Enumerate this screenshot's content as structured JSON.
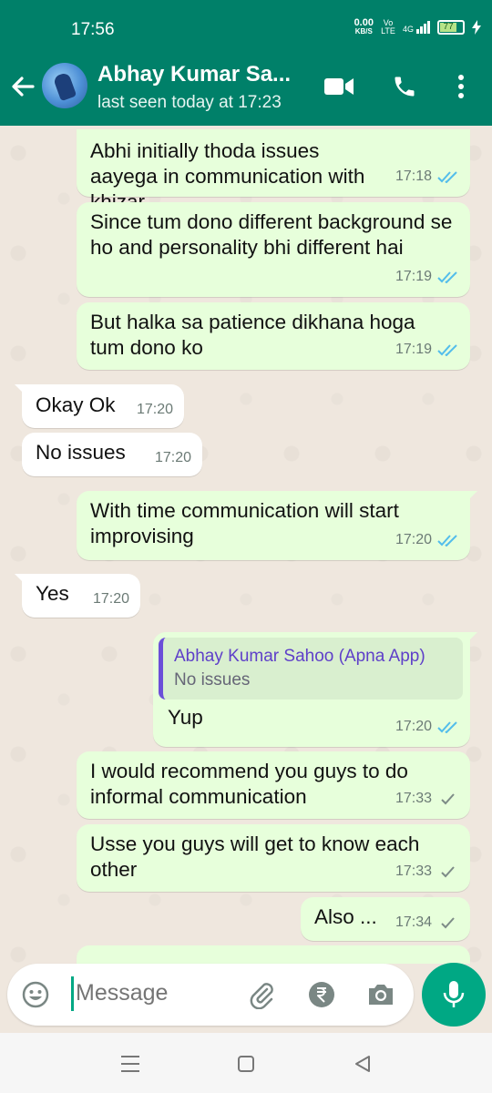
{
  "status_bar": {
    "time": "17:56",
    "net_speed_value": "0.00",
    "net_speed_unit": "KB/S",
    "volte": "Vo LTE",
    "network": "4G",
    "battery": "77"
  },
  "header": {
    "contact_name": "Abhay Kumar Sa...",
    "last_seen": "last seen today at 17:23",
    "icons": [
      "back-arrow-icon",
      "video-call-icon",
      "phone-icon",
      "more-vert-icon"
    ]
  },
  "messages": [
    {
      "dir": "out",
      "text": "Abhi initially thoda issues aayega in communication with khizar",
      "time": "17:18",
      "ticks": "read"
    },
    {
      "dir": "out",
      "text": "Since tum dono different background se ho and personality bhi different hai",
      "time": "17:19",
      "ticks": "read"
    },
    {
      "dir": "out",
      "text": "But halka sa patience dikhana hoga tum dono ko",
      "time": "17:19",
      "ticks": "read"
    },
    {
      "dir": "in",
      "text": "Okay Ok",
      "time": "17:20"
    },
    {
      "dir": "in",
      "text": "No issues",
      "time": "17:20"
    },
    {
      "dir": "out",
      "text": "With time communication will start improvising",
      "time": "17:20",
      "ticks": "read"
    },
    {
      "dir": "in",
      "text": "Yes",
      "time": "17:20"
    },
    {
      "dir": "out",
      "quote_name": "Abhay Kumar Sahoo (Apna App)",
      "quote_text": "No issues",
      "text": "Yup",
      "time": "17:20",
      "ticks": "read"
    },
    {
      "dir": "out",
      "text": "I would recommend you guys to do informal communication",
      "time": "17:33",
      "ticks": "sent"
    },
    {
      "dir": "out",
      "text": "Usse you guys will get to know each other",
      "time": "17:33",
      "ticks": "sent"
    },
    {
      "dir": "out",
      "text": "Also ...",
      "time": "17:34",
      "ticks": "sent"
    }
  ],
  "composer": {
    "placeholder": "Message",
    "icons": [
      "emoji-icon",
      "attach-icon",
      "rupee-payment-icon",
      "camera-icon",
      "mic-icon"
    ]
  },
  "colors": {
    "header_bg": "#008069",
    "outgoing_bubble": "#e7ffdb",
    "incoming_bubble": "#ffffff",
    "read_tick": "#53bdeb",
    "accent": "#00a884"
  },
  "navbar": {
    "icons": [
      "menu-icon",
      "home-icon",
      "back-icon"
    ]
  }
}
